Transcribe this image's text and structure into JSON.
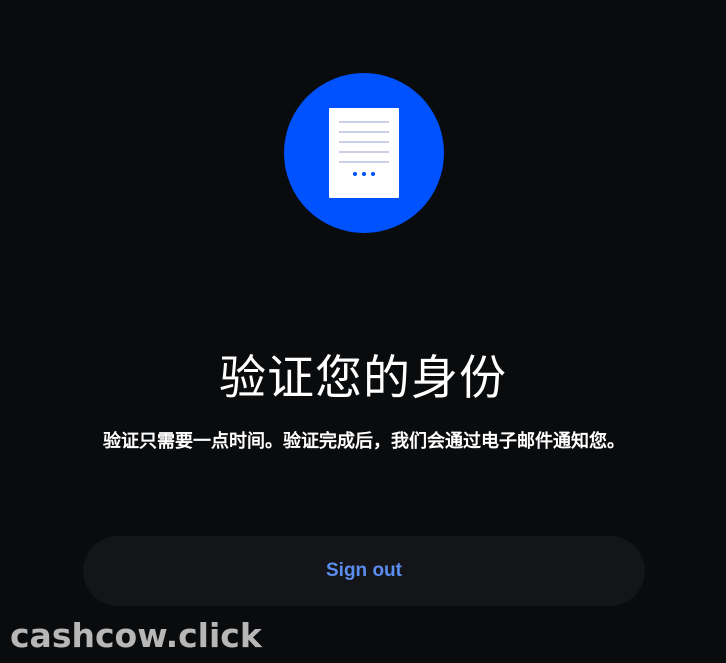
{
  "hero": {
    "icon": "document-icon"
  },
  "content": {
    "title": "验证您的身份",
    "subtitle": "验证只需要一点时间。验证完成后，我们会通过电子邮件通知您。"
  },
  "actions": {
    "sign_out_label": "Sign out"
  },
  "watermark": {
    "text": "cashcow.click"
  },
  "colors": {
    "background": "#0a0b0d",
    "accent": "#0052ff",
    "button_background": "#141519",
    "button_text": "#5b8def"
  }
}
